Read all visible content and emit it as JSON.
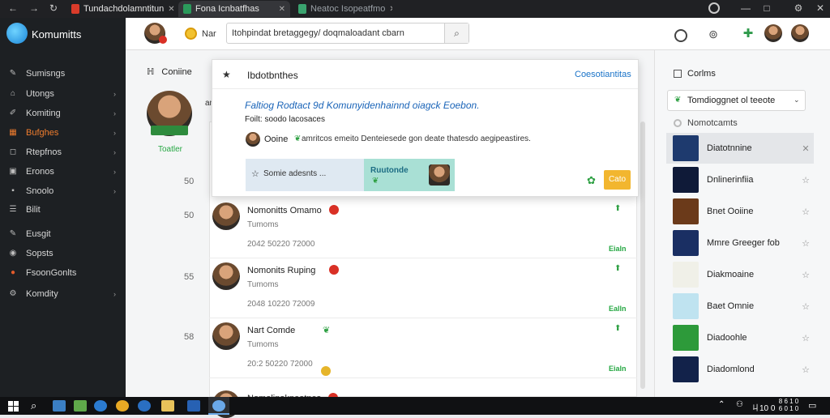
{
  "browser": {
    "tabs": [
      {
        "title": "Tundachdolamntitun"
      },
      {
        "title": "Fona Icnbatfhas"
      },
      {
        "title": "Neatoc Isopeatfmo"
      }
    ]
  },
  "sidebar": {
    "brand": "Komumitts",
    "items": [
      {
        "label": "Sumisngs",
        "icon": "pin-icon",
        "chevron": false
      },
      {
        "label": "Utongs",
        "icon": "tag-icon",
        "chevron": true
      },
      {
        "label": "Komiting",
        "icon": "pencil-icon",
        "chevron": true
      },
      {
        "label": "Bufghes",
        "icon": "grid-icon",
        "chevron": true,
        "active": true
      },
      {
        "label": "Rtepfnos",
        "icon": "chat-icon",
        "chevron": true
      },
      {
        "label": "Eronos",
        "icon": "box-icon",
        "chevron": true
      },
      {
        "label": "Snoolo",
        "icon": "square-icon",
        "chevron": true
      },
      {
        "label": "Bilit",
        "icon": "list-icon",
        "chevron": false
      },
      {
        "label": "Eusgit",
        "icon": "pin-icon",
        "chevron": false
      },
      {
        "label": "Sopsts",
        "icon": "globe-icon",
        "chevron": false
      },
      {
        "label": "FsoonGonlts",
        "icon": "flame-icon",
        "chevron": false
      },
      {
        "label": "Komdity",
        "icon": "gear-icon",
        "chevron": true
      }
    ],
    "accent": "#f07d2e"
  },
  "header": {
    "label": "Nar",
    "search_value": "Itohpindat bretaggegy/ doqmaloadant cbarn"
  },
  "profile": {
    "section_label": "Coniine",
    "status": "Toatler",
    "side_label": "am",
    "counts": [
      "50",
      "50",
      "55",
      "58"
    ]
  },
  "popup": {
    "title": "Ibdotbnthes",
    "link": "Coesotiantitas",
    "headline": "Faltiog Rodtact 9d Komunyidenhainnd oiagck Eoebon.",
    "subline": "Foilt: soodo lacosaces",
    "author": "Ooine",
    "author_text": "amritcos emeito Denteiesede gon deate thatesdo aegipeastires.",
    "banner_label": "Somie adesnts ...",
    "media_label": "Ruutonde",
    "button_label": "Cato"
  },
  "feed": [
    {
      "name": "Nomonitts Omamo",
      "sub": "Tumoms",
      "date": "2042 50220 72000",
      "action": "Eialn",
      "red_badge": true
    },
    {
      "name": "Nomonits Ruping",
      "sub": "Tumoms",
      "date": "2048 10220 72009",
      "action": "Ealln",
      "red_badge": true
    },
    {
      "name": "Nart Comde",
      "sub": "Tumoms",
      "date": "20:2 50220 72000",
      "action": "Eialn",
      "red_badge": false
    },
    {
      "name": "Nomolinakneatnes",
      "sub": "",
      "date": "",
      "action": "",
      "red_badge": true
    }
  ],
  "right_panel": {
    "heading": "Corlms",
    "dropdown_value": "Tomdioggnet ol teeote",
    "sub_heading": "Nomotcamts",
    "items": [
      {
        "name": "Diatotnnine",
        "action": "✕",
        "selected": true
      },
      {
        "name": "Dnlinerinfiia",
        "action": "☆",
        "selected": false
      },
      {
        "name": "Bnet Ooiine",
        "action": "☆",
        "selected": false
      },
      {
        "name": "Mmre Greeger fob",
        "action": "☆",
        "selected": false
      },
      {
        "name": "Diakmoaine",
        "action": "☆",
        "selected": false
      },
      {
        "name": "Baet Omnie",
        "action": "☆",
        "selected": false
      },
      {
        "name": "Diadoohle",
        "action": "☆",
        "selected": false
      },
      {
        "name": "Diadomlond",
        "action": "☆",
        "selected": false
      }
    ]
  },
  "taskbar": {
    "tray_time": "ㄐ10 0",
    "clock_top": "8 6 1 0",
    "clock_bottom": "6 0 1 0"
  }
}
